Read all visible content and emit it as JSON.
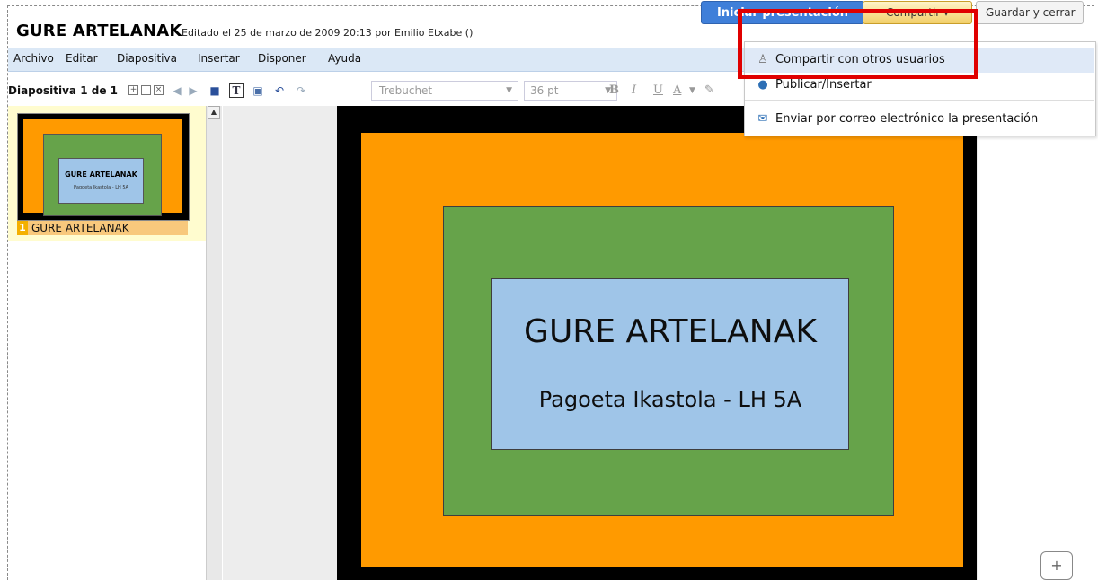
{
  "header": {
    "title": "GURE ARTELANAK",
    "meta": "Editado el 25 de marzo de 2009 20:13 por Emilio Etxabe ()",
    "present_label": "Iniciar presentación",
    "share_label": "Compartir ▾",
    "save_label": "Guardar y cerrar"
  },
  "menu": [
    "Archivo",
    "Editar",
    "Diapositiva",
    "Insertar",
    "Disponer",
    "Ayuda"
  ],
  "toolbar": {
    "slide_count": "Diapositiva 1 de 1",
    "font": "Trebuchet",
    "size": "36 pt",
    "bold": "B",
    "italic": "I",
    "underline": "U",
    "color": "A"
  },
  "share_menu": {
    "items": [
      {
        "label": "Compartir con otros usuarios",
        "icon": "users-icon"
      },
      {
        "label": "Publicar/Insertar",
        "icon": "globe-icon"
      },
      {
        "label": "Enviar por correo electrónico la presentación",
        "icon": "envelope-icon"
      }
    ]
  },
  "thumbnail": {
    "number": "1",
    "name": "GURE ARTELANAK",
    "title": "GURE ARTELANAK",
    "subtitle": "Pagoeta Ikastola - LH 5A"
  },
  "slide": {
    "title": "GURE ARTELANAK",
    "subtitle": "Pagoeta Ikastola - LH 5A"
  },
  "colors": {
    "orange": "#ff9a00",
    "green": "#66a34a",
    "blue": "#9fc5e8",
    "highlight_red": "#e00000",
    "present_blue": "#3f7fd9"
  }
}
